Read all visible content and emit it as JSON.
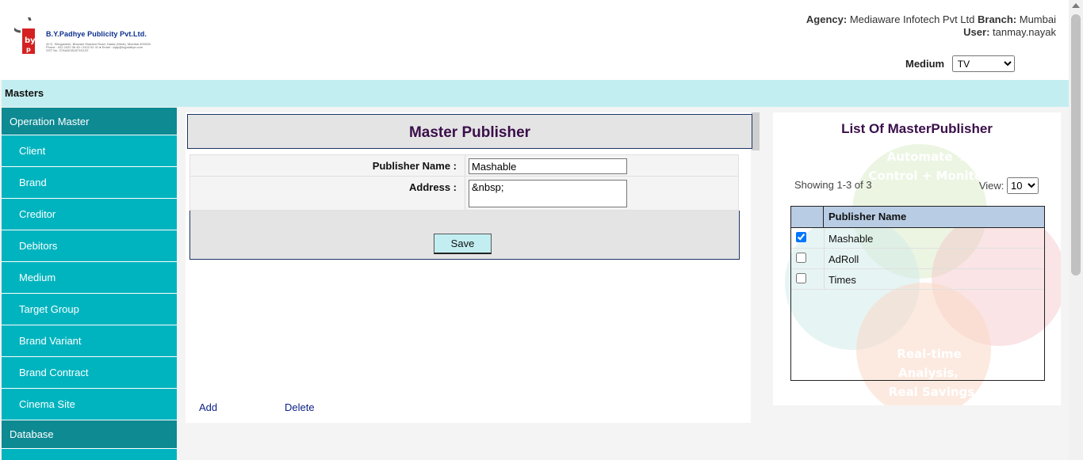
{
  "header": {
    "company_name": "B.Y.Padhye Publicity Pvt.Ltd.",
    "company_address": "32 E, Shivganesh, Bhavani Shankar Road, Dadar (West), Mumbai 400028.",
    "company_contact": "Phone : 022 2422 06 45 / 2422 02 41 ● Email : vijay@bypadhye.com",
    "company_gst": "GST No. 27AAACB1871D1ZZ",
    "agency_label": "Agency:",
    "agency_value": "Mediaware Infotech Pvt Ltd",
    "branch_label": "Branch:",
    "branch_value": "Mumbai",
    "user_label": "User:",
    "user_value": "tanmay.nayak",
    "medium_label": "Medium",
    "medium_selected": "TV"
  },
  "masters_bar": {
    "title": "Masters"
  },
  "sidebar": {
    "section_title": "Operation Master",
    "items": [
      {
        "label": "Client"
      },
      {
        "label": "Brand"
      },
      {
        "label": "Creditor"
      },
      {
        "label": "Debitors"
      },
      {
        "label": "Medium"
      },
      {
        "label": "Target Group"
      },
      {
        "label": "Brand Variant"
      },
      {
        "label": "Brand Contract"
      },
      {
        "label": "Cinema Site"
      }
    ],
    "database_title": "Database"
  },
  "form": {
    "title": "Master Publisher",
    "publisher_name_label": "Publisher Name :",
    "publisher_name_value": "Mashable",
    "address_label": "Address :",
    "address_value": "&nbsp;",
    "save_label": "Save",
    "add_label": "Add",
    "delete_label": "Delete"
  },
  "list": {
    "title": "List Of MasterPublisher",
    "showing": "Showing 1-3 of 3",
    "view_label": "View:",
    "view_selected": "10",
    "column_header": "Publisher Name",
    "rows": [
      {
        "name": "Mashable",
        "checked": true
      },
      {
        "name": "AdRoll",
        "checked": false
      },
      {
        "name": "Times",
        "checked": false
      }
    ],
    "watermark_texts": [
      "Automate +",
      "Control + Monitor",
      "Real-time",
      "Analysis,",
      "Real Savings"
    ]
  },
  "colors": {
    "sidebar_section": "#0e8a93",
    "sidebar_item": "#00b4bf",
    "masters_bar": "#c3eef1",
    "title_text": "#3a0f4a",
    "link": "#0b1f86",
    "list_header": "#b8cce4"
  }
}
